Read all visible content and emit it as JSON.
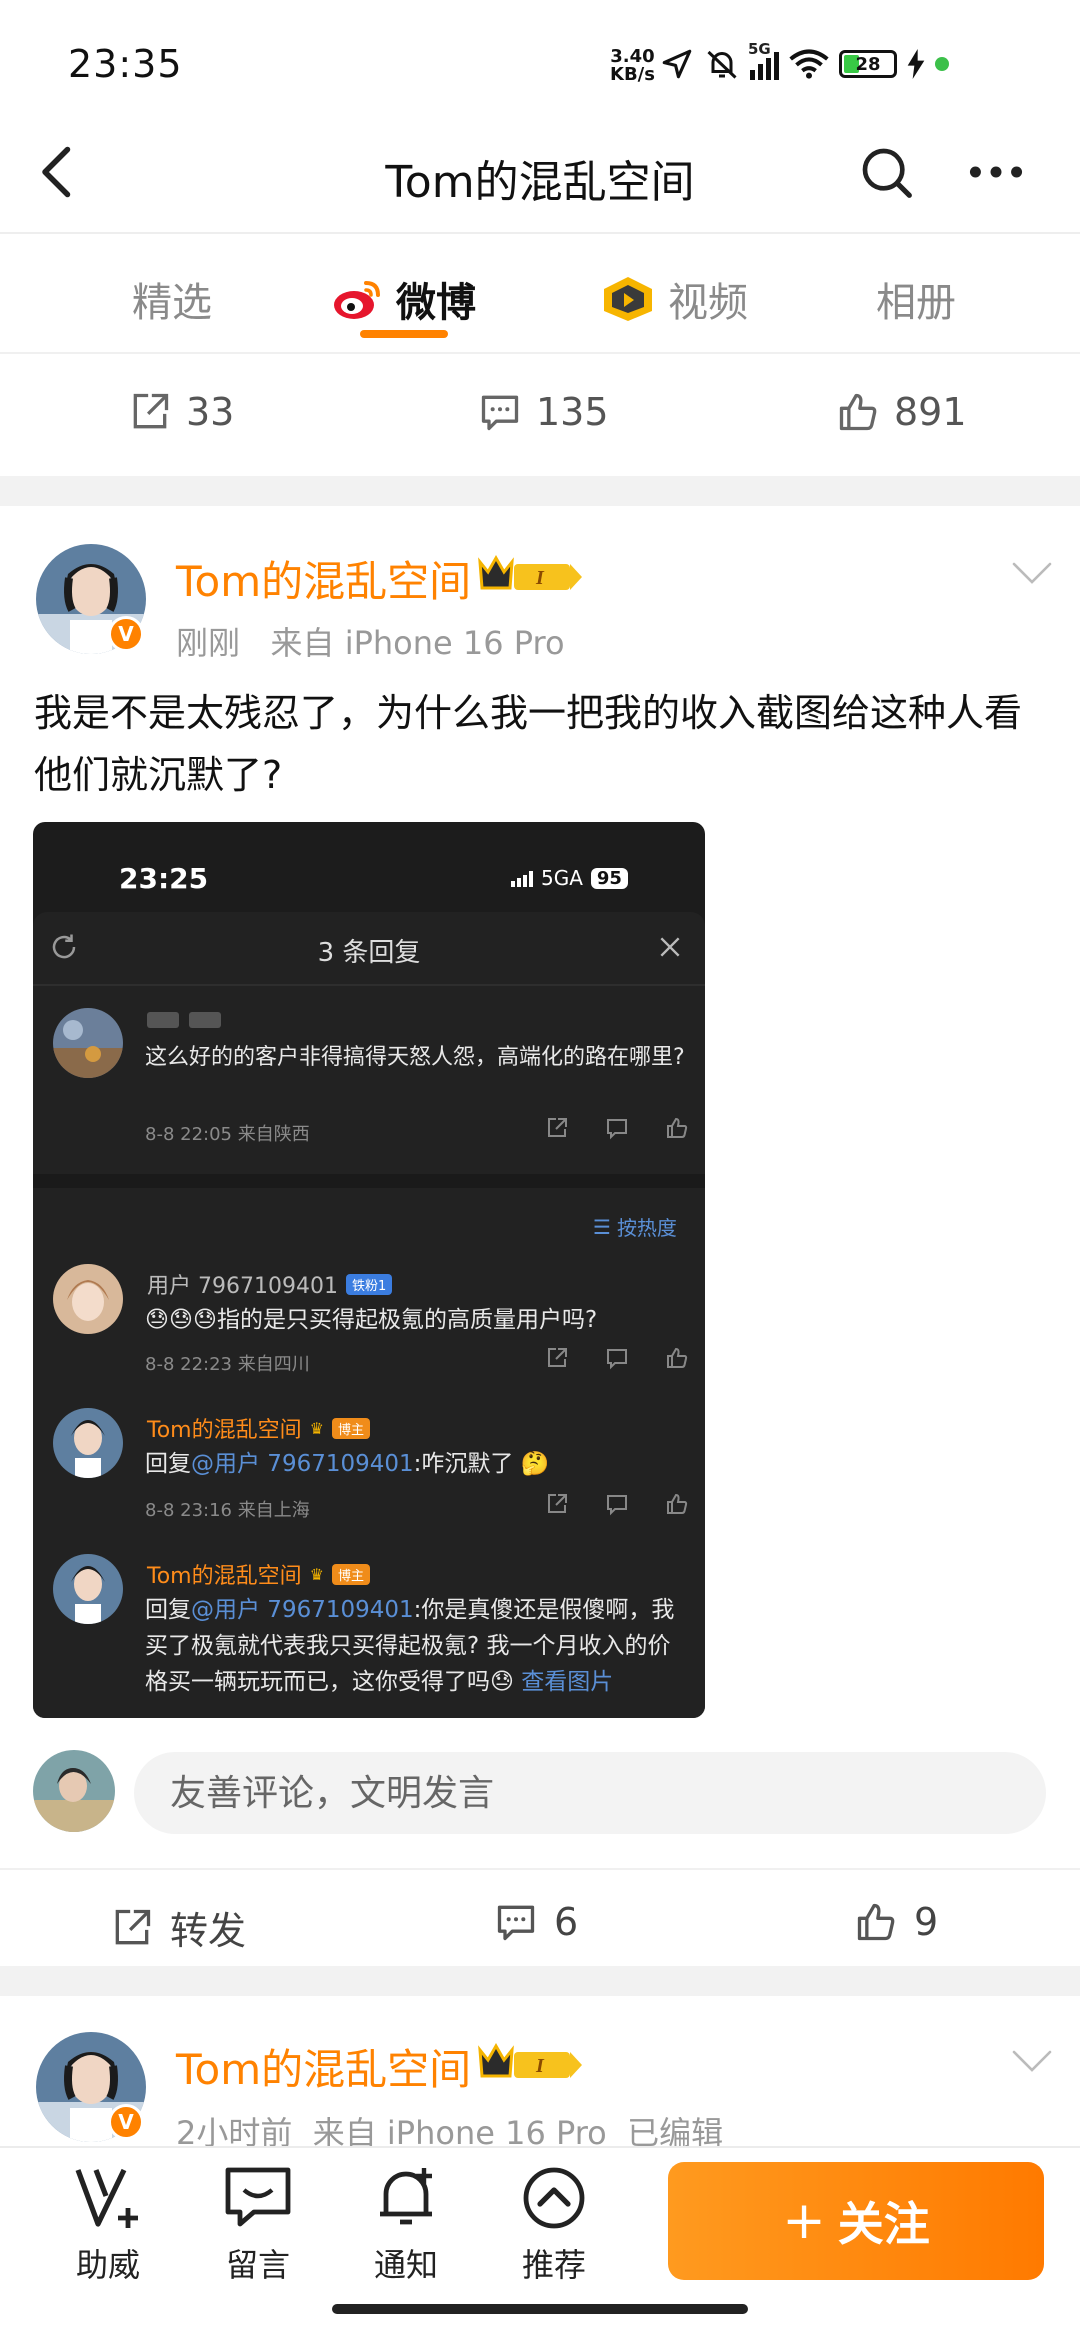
{
  "status_bar": {
    "time": "23:35",
    "net_speed_value": "3.40",
    "net_speed_unit": "KB/s",
    "network": "5G",
    "battery": "28"
  },
  "nav": {
    "title": "Tom的混乱空间"
  },
  "tabs": [
    {
      "label": "精选"
    },
    {
      "label": "微博"
    },
    {
      "label": "视频"
    },
    {
      "label": "相册"
    }
  ],
  "prev_post_stats": {
    "repost": "33",
    "comment": "135",
    "like": "891"
  },
  "post": {
    "author": "Tom的混乱空间",
    "level": "I",
    "time": "刚刚",
    "source": "来自 iPhone 16 Pro",
    "verified_badge": "V",
    "text": "我是不是太残忍了，为什么我一把我的收入截图给这种人看他们就沉默了?",
    "screenshot": {
      "time": "23:25",
      "network": "5GA",
      "battery": "95",
      "header_title": "3 条回复",
      "root_comment": {
        "text": "这么好的的客户非得搞得天怒人怨，高端化的路在哪里?",
        "meta": "8-8 22:05  来自陕西"
      },
      "sort_label": "按热度",
      "replies": [
        {
          "name": "用户 7967109401",
          "tag": "铁粉1",
          "emoji": "😓😓😓",
          "text": "指的是只买得起极氪的高质量用户吗?",
          "meta": "8-8 22:23  来自四川"
        },
        {
          "name": "Tom的混乱空间",
          "tag": "博主",
          "prefix": "回复",
          "mention": "@用户 7967109401",
          "text": ":咋沉默了",
          "emoji": "🤔",
          "meta": "8-8 23:16  来自上海"
        },
        {
          "name": "Tom的混乱空间",
          "tag": "博主",
          "prefix": "回复",
          "mention": "@用户 7967109401",
          "text": ":你是真傻还是假傻啊，我买了极氪就代表我只买得起极氪? 我一个月收入的价格买一辆玩玩而已，这你受得了吗",
          "emoji": "😓",
          "more": "查看图片"
        }
      ]
    },
    "comment_placeholder": "友善评论，文明发言",
    "repost_label": "转发",
    "comment_count": "6",
    "like_count": "9"
  },
  "next_post": {
    "author": "Tom的混乱空间",
    "level": "I",
    "time": "2小时前",
    "source": "来自 iPhone 16 Pro",
    "edited": "已编辑"
  },
  "bottom_bar": {
    "items": [
      {
        "label": "助威"
      },
      {
        "label": "留言"
      },
      {
        "label": "通知"
      },
      {
        "label": "推荐"
      }
    ],
    "follow": "关注"
  },
  "colors": {
    "brand_orange": "#ff8200",
    "text": "#111111",
    "muted": "#999999"
  }
}
